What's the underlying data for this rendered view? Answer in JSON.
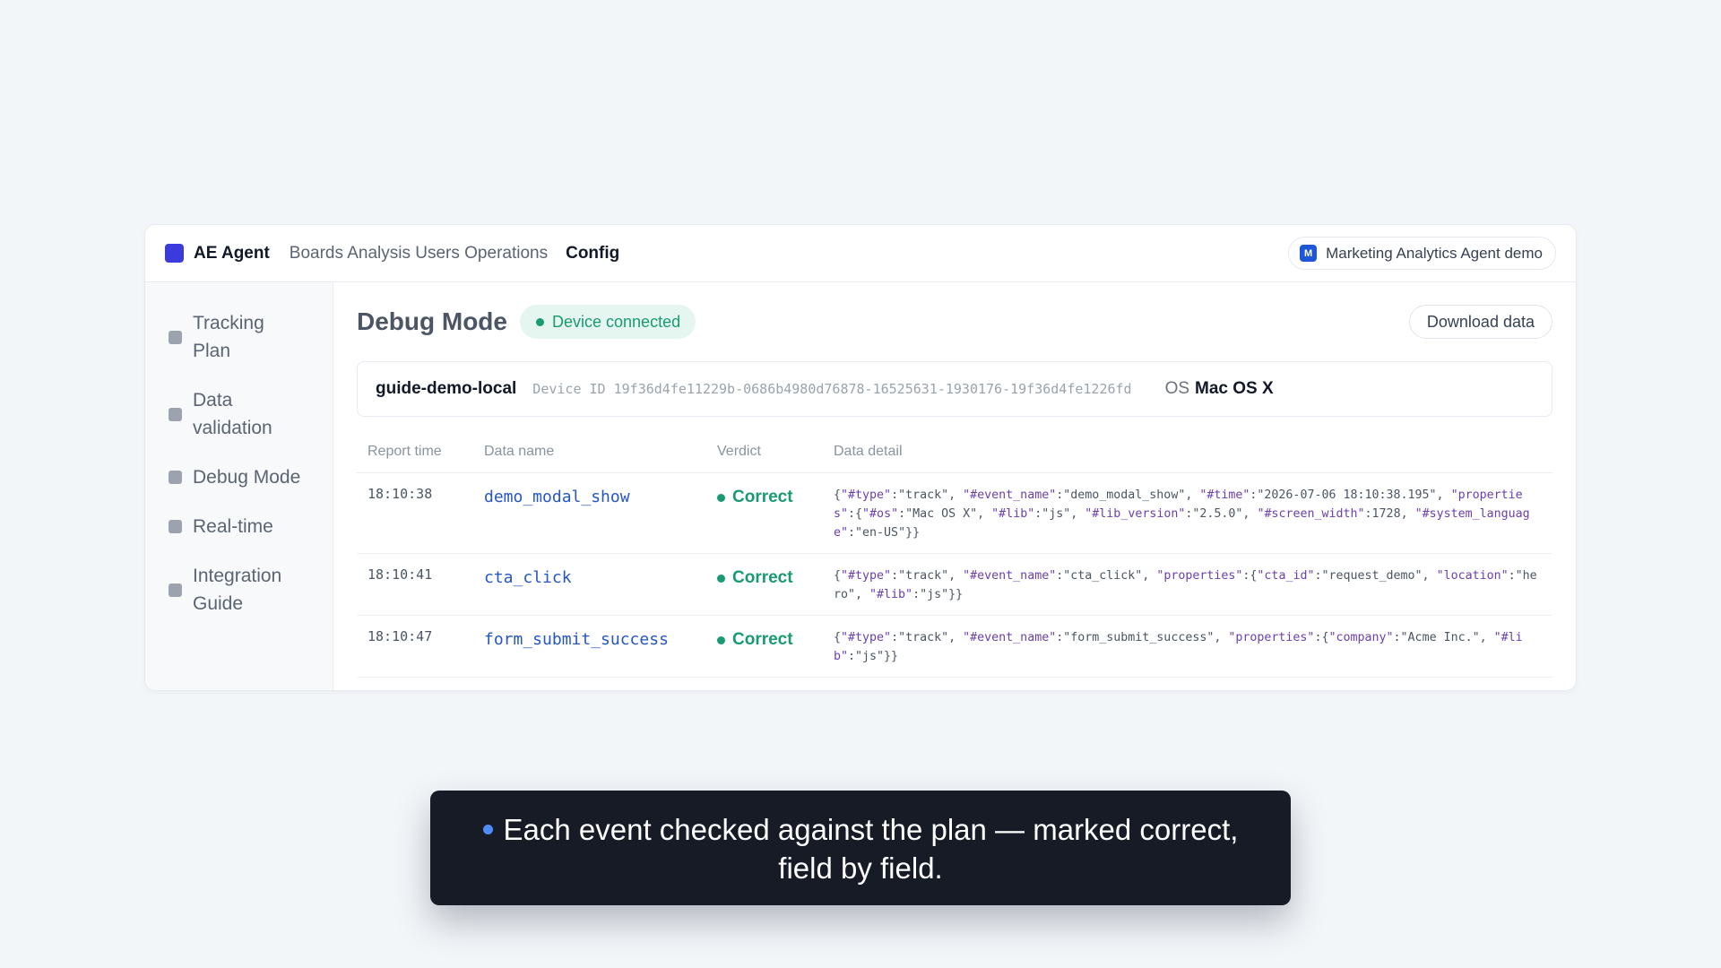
{
  "header": {
    "brand": "AE Agent",
    "nav": [
      "Boards",
      "Analysis",
      "Users",
      "Operations"
    ],
    "nav_text": "Boards Analysis Users Operations",
    "config_label": "Config",
    "workspace_badge": "M",
    "workspace_name": "Marketing Analytics Agent demo"
  },
  "sidebar": {
    "items": [
      {
        "label": "Tracking Plan"
      },
      {
        "label": "Data validation"
      },
      {
        "label": "Debug Mode"
      },
      {
        "label": "Real-time"
      },
      {
        "label": "Integration Guide"
      }
    ]
  },
  "main": {
    "title": "Debug Mode",
    "status": "Device connected",
    "download_label": "Download data",
    "device": {
      "name": "guide-demo-local",
      "id_text": "Device ID 19f36d4fe11229b-0686b4980d76878-16525631-1930176-19f36d4fe1226fd",
      "os_label": "OS",
      "os_value": "Mac OS X"
    },
    "table": {
      "headers": [
        "Report time",
        "Data name",
        "Verdict",
        "Data detail"
      ],
      "rows": [
        {
          "time": "18:10:38",
          "name": "demo_modal_show",
          "verdict": "Correct",
          "detail": "{\"#type\":\"track\", \"#event_name\":\"demo_modal_show\", \"#time\":\"2026-07-06 18:10:38.195\", \"properties\":{\"#os\":\"Mac OS X\", \"#lib\":\"js\", \"#lib_version\":\"2.5.0\", \"#screen_width\":1728, \"#system_language\":\"en-US\"}}"
        },
        {
          "time": "18:10:41",
          "name": "cta_click",
          "verdict": "Correct",
          "detail": "{\"#type\":\"track\", \"#event_name\":\"cta_click\", \"properties\":{\"cta_id\":\"request_demo\", \"location\":\"hero\", \"#lib\":\"js\"}}"
        },
        {
          "time": "18:10:47",
          "name": "form_submit_success",
          "verdict": "Correct",
          "detail": "{\"#type\":\"track\", \"#event_name\":\"form_submit_success\", \"properties\":{\"company\":\"Acme Inc.\", \"#lib\":\"js\"}}"
        }
      ]
    }
  },
  "caption": "Each event checked against the plan — marked correct, field by field.",
  "colors": {
    "brand": "#3b3bdb",
    "success": "#1a9a72",
    "link": "#2555c7",
    "json_key": "#6b3fb0",
    "caption_bg": "#161b26",
    "caption_dot": "#4f8cf7"
  }
}
